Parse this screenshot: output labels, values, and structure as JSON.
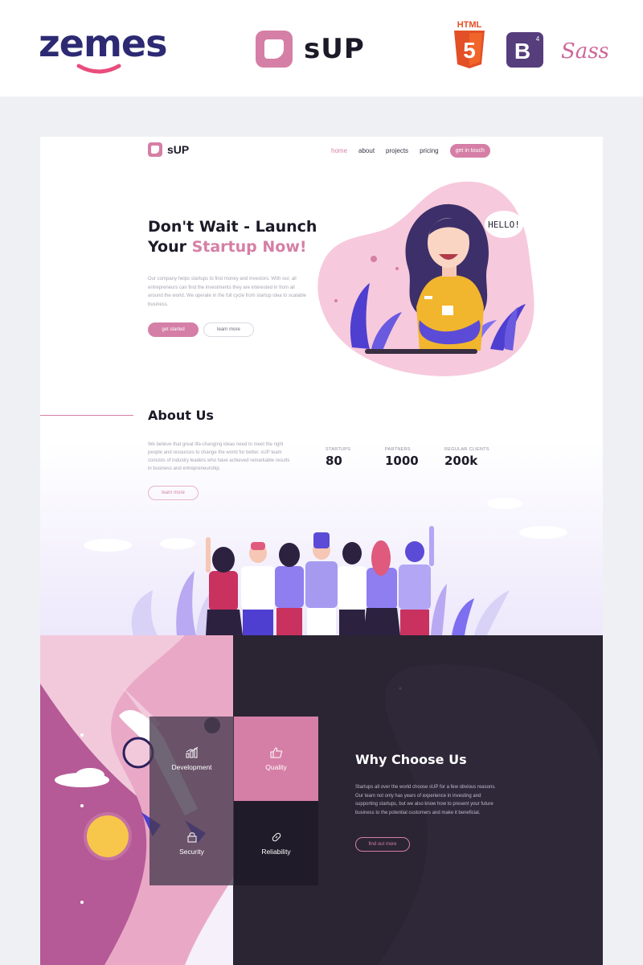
{
  "banner": {
    "vendor": "zemes",
    "product": "sUP",
    "tech_html": "HTML",
    "tech_bootstrap": "B",
    "tech_bootstrap_version": "4",
    "tech_sass": "Sass"
  },
  "nav": {
    "brand": "sUP",
    "links": [
      "home",
      "about",
      "projects",
      "pricing"
    ],
    "active_link": "home",
    "cta": "get in touch"
  },
  "hero": {
    "title_line1": "Don't Wait - Launch",
    "title_line2_plain": "Your ",
    "title_line2_accent": "Startup Now!",
    "text": "Our company helps startups to find money and investors. With our, all entrepreneurs can find the investments they are interested in from all around the world. We operate in the full cycle from startup idea to scalable business.",
    "btn_primary": "get started",
    "btn_secondary": "learn more",
    "bubble": "HELLO!"
  },
  "about": {
    "title": "About Us",
    "text": "We believe that great life-changing ideas need to meet the right people and resources to change the world for better. sUP team consists of industry leaders who have achieved remarkable results in business and entrepreneurship.",
    "button": "learn more",
    "stats": [
      {
        "label": "STARTUPS",
        "value": "80"
      },
      {
        "label": "PARTNERS",
        "value": "1000"
      },
      {
        "label": "REGULAR CLIENTS",
        "value": "200k"
      }
    ]
  },
  "why": {
    "title": "Why Choose Us",
    "text": "Startups all over the world choose sUP for a few obvious reasons. Our team not only has years of experience in investing and supporting startups, but we also know how to present your future business to the potential customers and make it beneficial.",
    "button": "find out more",
    "tiles": [
      "Development",
      "Quality",
      "Security",
      "Reliability"
    ]
  },
  "colors": {
    "accent": "#d57fa6",
    "dark": "#2a2433",
    "navy": "#2d2a73",
    "violet": "#5b4bd6"
  }
}
